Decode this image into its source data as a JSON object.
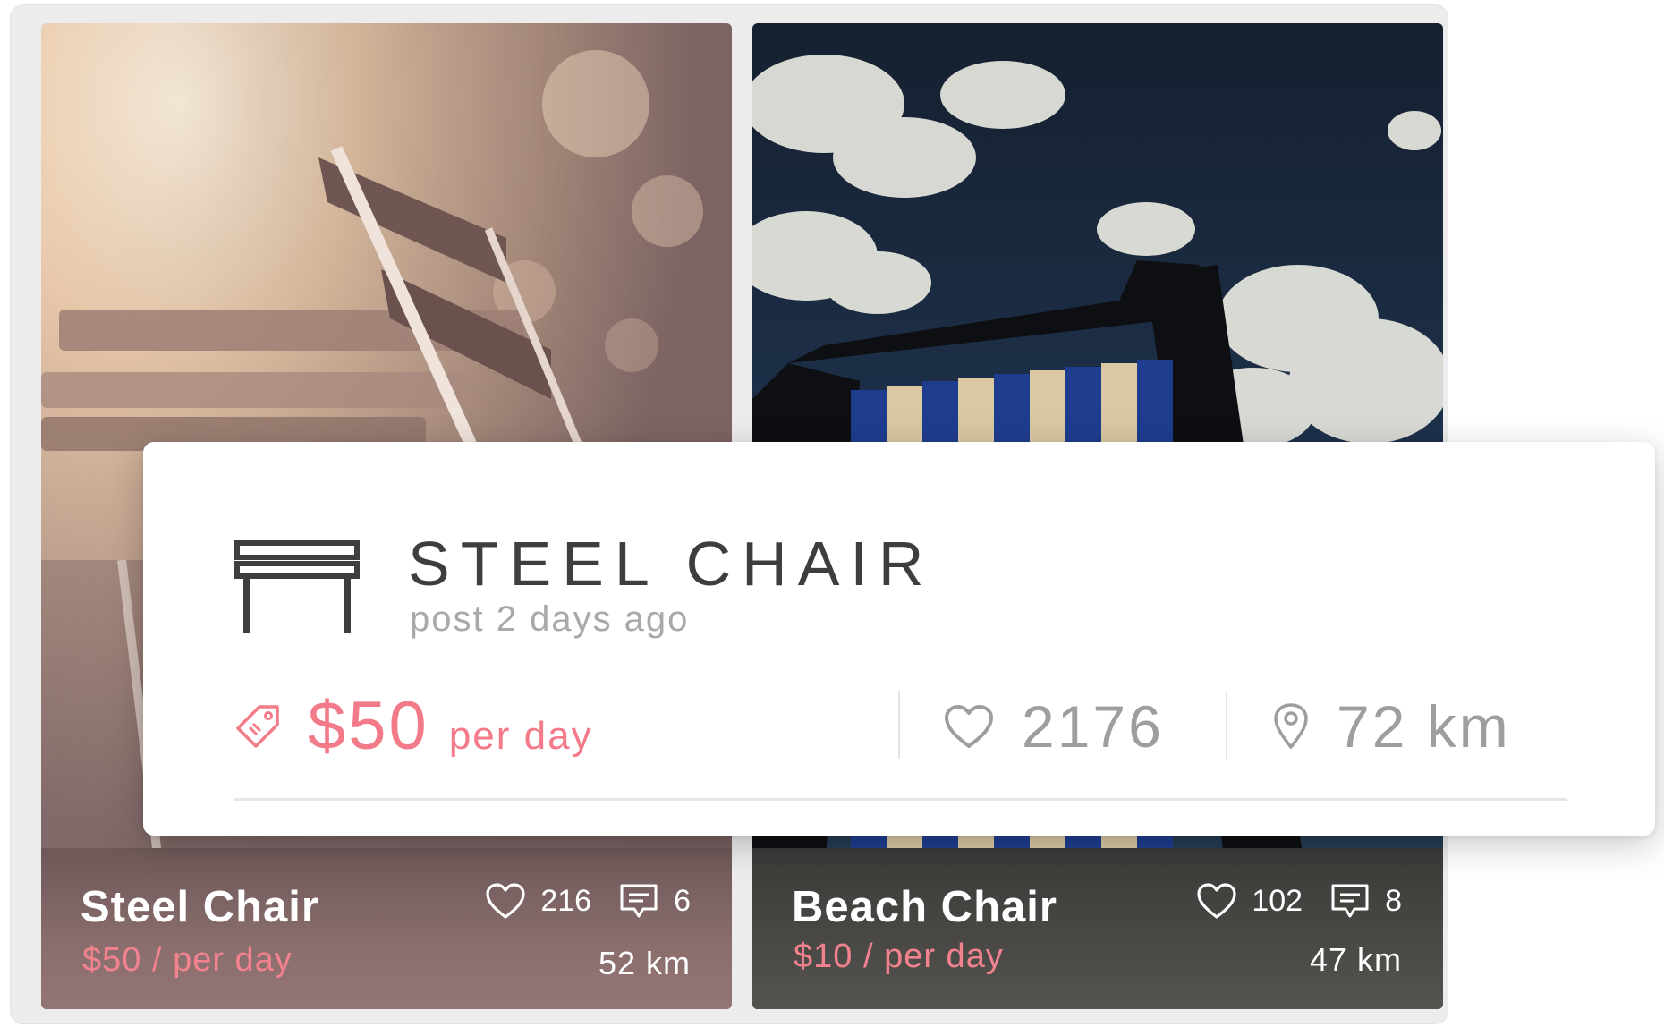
{
  "listings": [
    {
      "title": "Steel Chair",
      "price": "$50 / per day",
      "likes": "216",
      "comments": "6",
      "distance": "52 km"
    },
    {
      "title": "Beach Chair",
      "price": "$10 / per day",
      "likes": "102",
      "comments": "8",
      "distance": "47 km"
    }
  ],
  "detail": {
    "icon": "bench-icon",
    "title": "STEEL CHAIR",
    "subtitle": "post 2 days ago",
    "price_amount": "$50",
    "price_unit": "per day",
    "likes": "2176",
    "distance": "72 km"
  },
  "colors": {
    "accent": "#f37b89",
    "muted_text": "#9e9e9e",
    "title_text": "#3e3e3e"
  }
}
